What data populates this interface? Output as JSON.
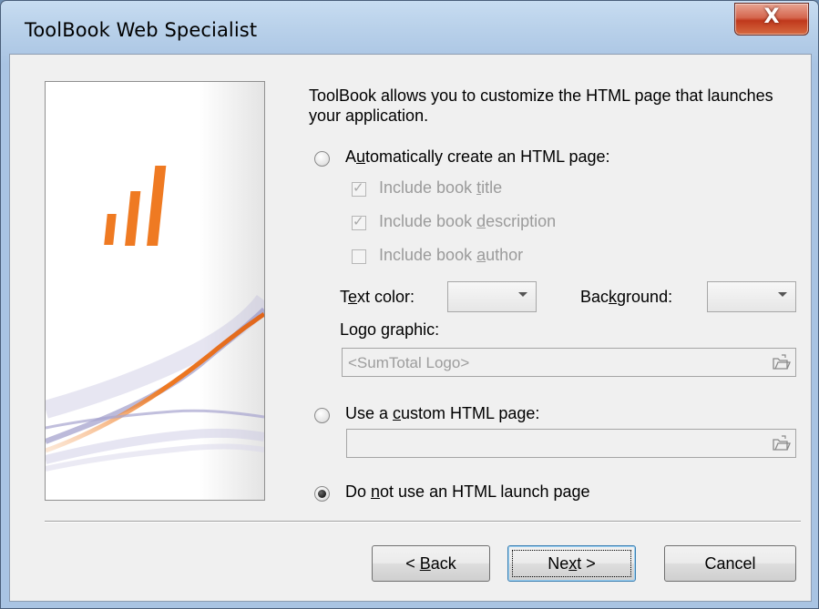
{
  "window": {
    "title": "ToolBook Web Specialist",
    "close_glyph": "X"
  },
  "content": {
    "intro": "ToolBook allows you to customize the HTML page that launches your application."
  },
  "options": {
    "auto": {
      "pre": "A",
      "key": "u",
      "post": "tomatically create an HTML page:",
      "selected": false
    },
    "checks": {
      "title": {
        "pre": "Include book ",
        "key": "t",
        "post": "itle",
        "checked": true
      },
      "description": {
        "pre": "Include book ",
        "key": "d",
        "post": "escription",
        "checked": true
      },
      "author": {
        "pre": "Include book ",
        "key": "a",
        "post": "uthor",
        "checked": false
      }
    },
    "text_color": {
      "pre": "T",
      "key": "e",
      "post": "xt color:"
    },
    "background": {
      "pre": "Bac",
      "key": "k",
      "post": "ground:"
    },
    "logo": {
      "pre": "Logo ",
      "key": "g",
      "post": "raphic:",
      "value": "<SumTotal Logo>"
    },
    "custom": {
      "pre": "Use a ",
      "key": "c",
      "post": "ustom HTML page:",
      "value": "",
      "selected": false
    },
    "none": {
      "pre": "Do ",
      "key": "n",
      "post": "ot use an HTML launch page",
      "selected": true
    }
  },
  "buttons": {
    "back": {
      "pre": "< ",
      "key": "B",
      "post": "ack"
    },
    "next": {
      "pre": "Ne",
      "key": "x",
      "post": "t >"
    },
    "cancel": {
      "label": "Cancel"
    }
  },
  "colors": {
    "accent_orange": "#ef7a22",
    "swoosh_purple": "#7b78b4",
    "disabled_text": "#9b9b9b"
  }
}
